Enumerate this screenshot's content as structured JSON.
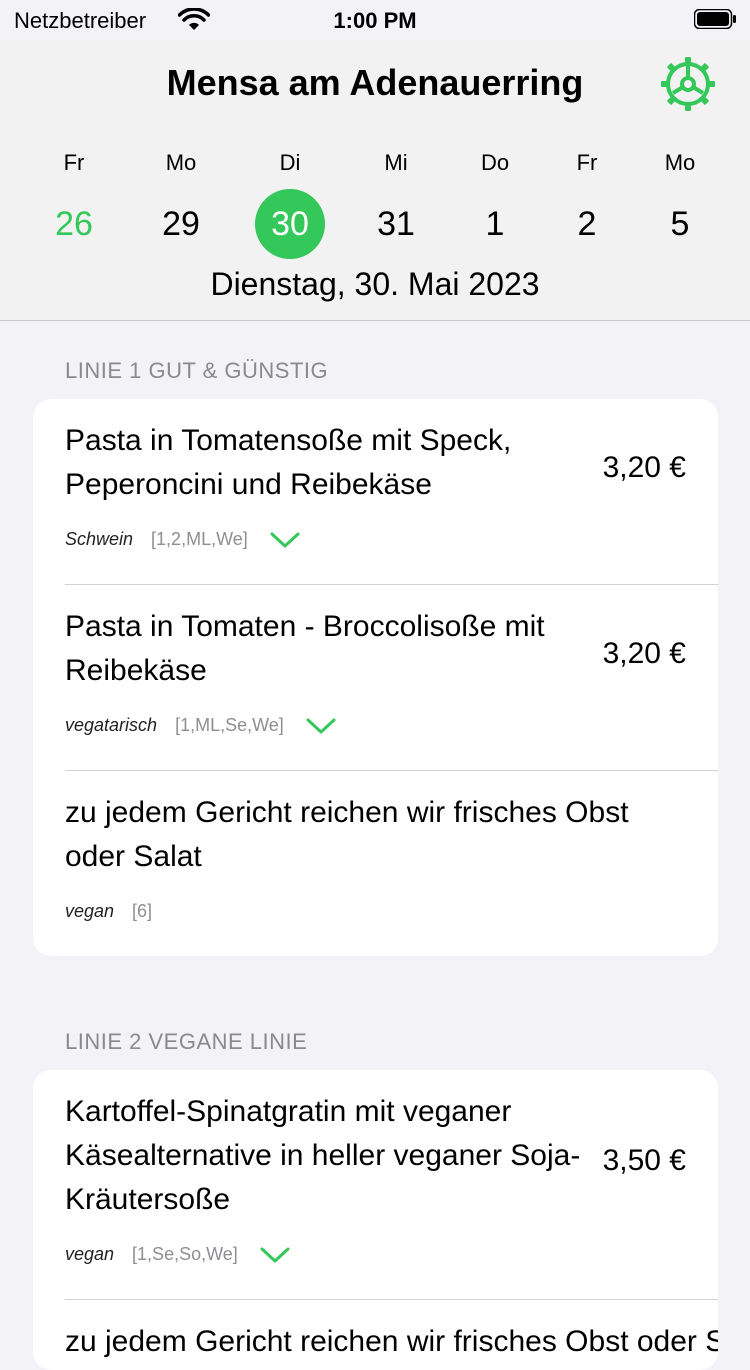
{
  "status": {
    "carrier": "Netzbetreiber",
    "time": "1:00 PM"
  },
  "header": {
    "title": "Mensa am Adenauerring",
    "settings_icon": "gear-icon"
  },
  "days": [
    {
      "dow": "Fr",
      "num": "26",
      "state": "past"
    },
    {
      "dow": "Mo",
      "num": "29",
      "state": "normal"
    },
    {
      "dow": "Di",
      "num": "30",
      "state": "selected"
    },
    {
      "dow": "Mi",
      "num": "31",
      "state": "normal"
    },
    {
      "dow": "Do",
      "num": "1",
      "state": "normal"
    },
    {
      "dow": "Fr",
      "num": "2",
      "state": "normal"
    },
    {
      "dow": "Mo",
      "num": "5",
      "state": "normal"
    }
  ],
  "full_date": "Dienstag, 30. Mai 2023",
  "accent": "#34c759",
  "sections": [
    {
      "title": "LINIE 1 GUT & GÜNSTIG",
      "items": [
        {
          "name": "Pasta in Tomatensoße mit Speck, Peperoncini und Reibekäse",
          "price": "3,20 €",
          "tag": "Schwein",
          "codes": "[1,2,ML,We]",
          "expandable": true
        },
        {
          "name": "Pasta in Tomaten - Broccolisoße mit Reibekäse",
          "price": "3,20 €",
          "tag": "vegatarisch",
          "codes": "[1,ML,Se,We]",
          "expandable": true
        },
        {
          "name": "zu jedem Gericht reichen wir frisches Obst oder Salat",
          "price": "",
          "tag": "vegan",
          "codes": "[6]",
          "expandable": false
        }
      ]
    },
    {
      "title": "LINIE 2 VEGANE LINIE",
      "items": [
        {
          "name": "Kartoffel-Spinatgratin mit veganer Käsealternative in heller veganer Soja-Kräutersoße",
          "price": "3,50 €",
          "tag": "vegan",
          "codes": "[1,Se,So,We]",
          "expandable": true
        },
        {
          "name": "zu jedem Gericht reichen wir frisches Obst oder Salat",
          "price": "",
          "tag": "",
          "codes": "",
          "expandable": false
        }
      ]
    }
  ]
}
